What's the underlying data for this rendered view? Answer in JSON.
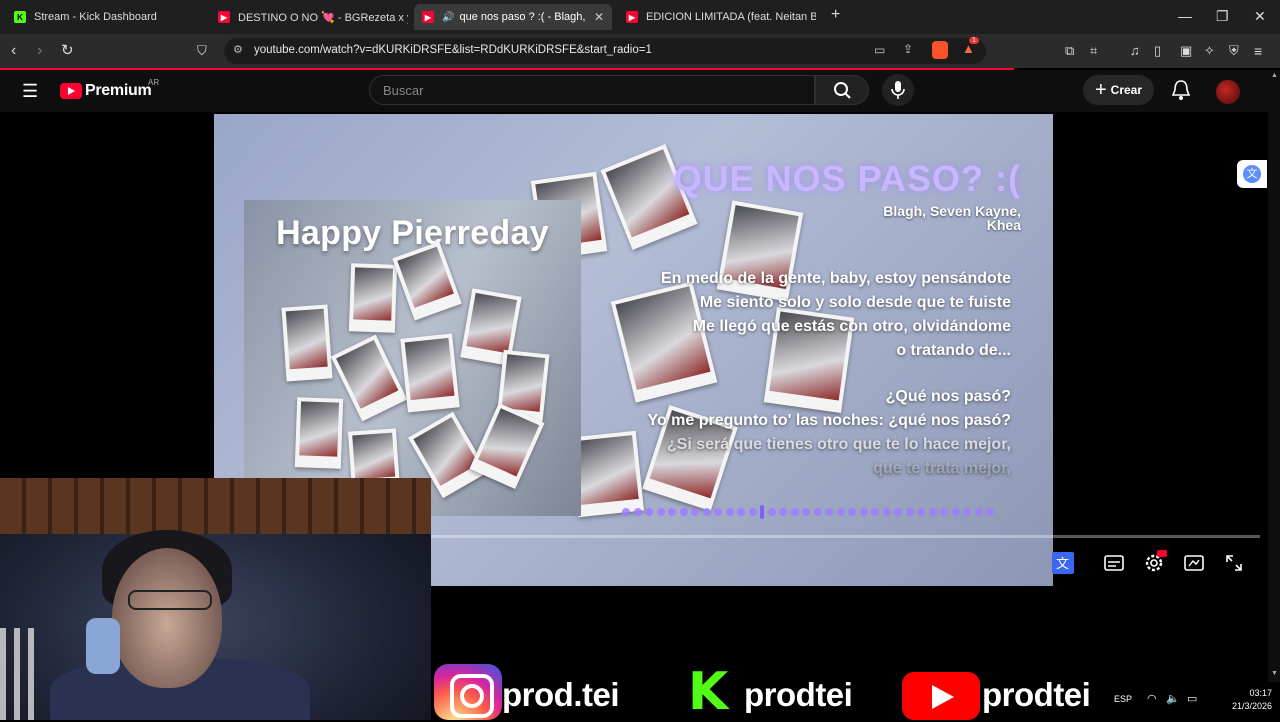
{
  "browser": {
    "tabs": [
      {
        "title": "Stream - Kick Dashboard",
        "favicon": "kick-icon",
        "active": false
      },
      {
        "title": "DESTINO O NO 💘 - BGRezeta x youn",
        "favicon": "youtube-icon",
        "active": false
      },
      {
        "title": "que nos paso ? :( - Blagh, Sev",
        "favicon": "youtube-icon",
        "active": true,
        "audio": "speaker-icon"
      },
      {
        "title": "EDICION LIMITADA (feat. Neitan BGR",
        "favicon": "youtube-icon",
        "active": false
      }
    ],
    "url": "youtube.com/watch?v=dKURKiDRSFE&list=RDdKURKiDRSFE&start_radio=1",
    "new_tab_label": "+",
    "extension_badge": "1",
    "brave_badge": "78"
  },
  "youtube": {
    "logo_text": "Premium",
    "region": "AR",
    "search_placeholder": "Buscar",
    "create_label": "Crear",
    "accent": "#ff0033"
  },
  "video": {
    "cover_title": "Happy Pierreday",
    "song_title": "QUE NOS PASO? :(",
    "artists_line1": "Blagh, Seven Kayne,",
    "artists_line2": "Khea",
    "lyrics": [
      "En medio de la gente, baby, estoy pensándote",
      "Me siento solo y solo desde que te fuiste",
      "Me llegó que estás con otro, olvidándome",
      "o tratando de...",
      "¿Qué nos pasó?",
      "Yo me pregunto to' las noches: ¿qué nos pasó?",
      "¿Si será que tienes otro que te lo hace mejor,",
      "que te trata mejor,"
    ],
    "title_color": "#c8b6ff",
    "dot_color": "#9d7cff"
  },
  "overlay": {
    "handles": [
      "prod.tei",
      "prodtei",
      "prodtei"
    ]
  },
  "taskbar": {
    "language": "ESP",
    "time": "03:17",
    "date": "21/3/2026"
  }
}
